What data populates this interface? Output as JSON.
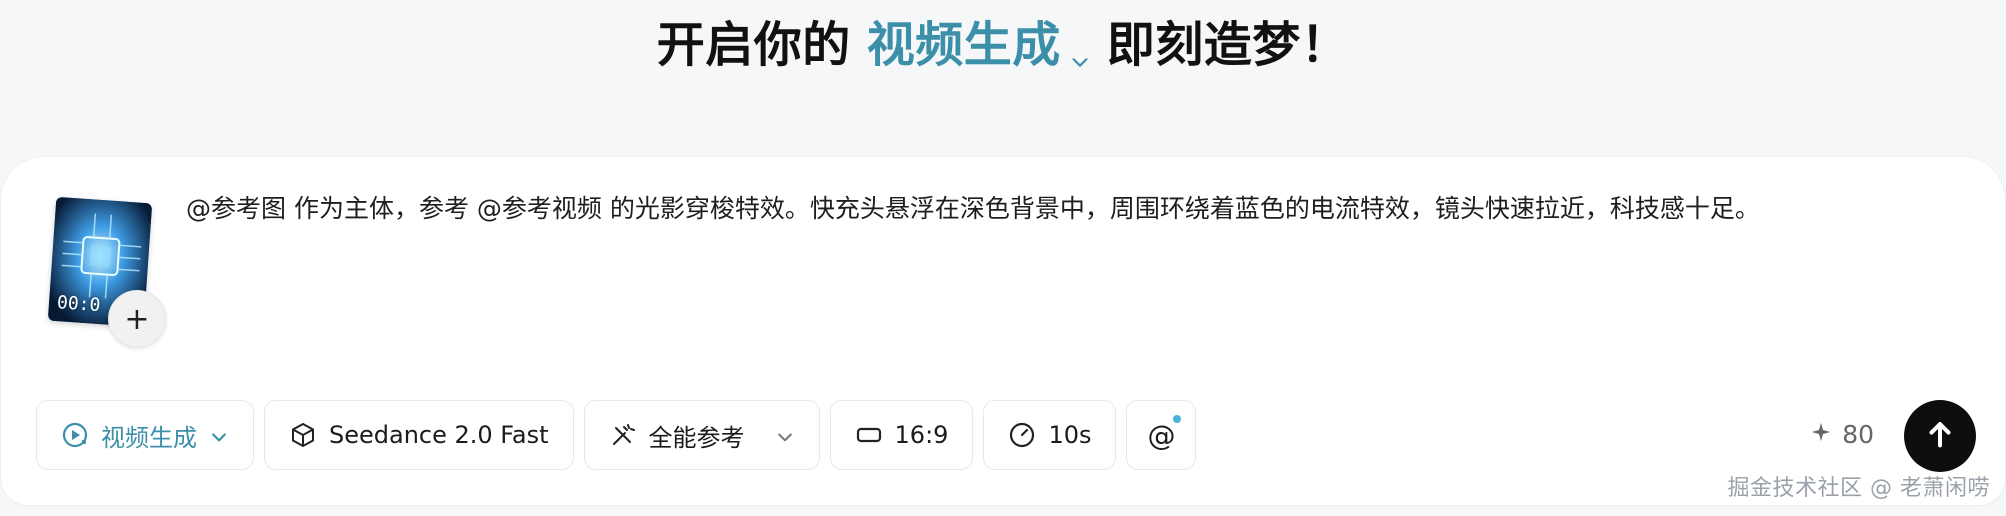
{
  "header": {
    "prefix": "开启你的",
    "mode": "视频生成",
    "suffix": "即刻造梦！"
  },
  "composer": {
    "thumbnail": {
      "timecode": "00:0"
    },
    "prompt": "@参考图 作为主体，参考 @参考视频 的光影穿梭特效。快充头悬浮在深色背景中，周围环绕着蓝色的电流特效，镜头快速拉近，科技感十足。"
  },
  "toolbar": {
    "mode_label": "视频生成",
    "model_label": "Seedance 2.0 Fast",
    "reference_label": "全能参考",
    "ratio_label": "16:9",
    "duration_label": "10s",
    "mention_label": "@"
  },
  "credits": {
    "icon": "sparkle-icon",
    "value": "80"
  },
  "watermark": {
    "text": "掘金技术社区 @ 老萧闲唠"
  },
  "colors": {
    "accent": "#3b8fa8",
    "mention_dot": "#4db3d6",
    "submit_bg": "#0e0e0e",
    "card_bg": "#ffffff",
    "page_bg": "#f6f7f9"
  }
}
